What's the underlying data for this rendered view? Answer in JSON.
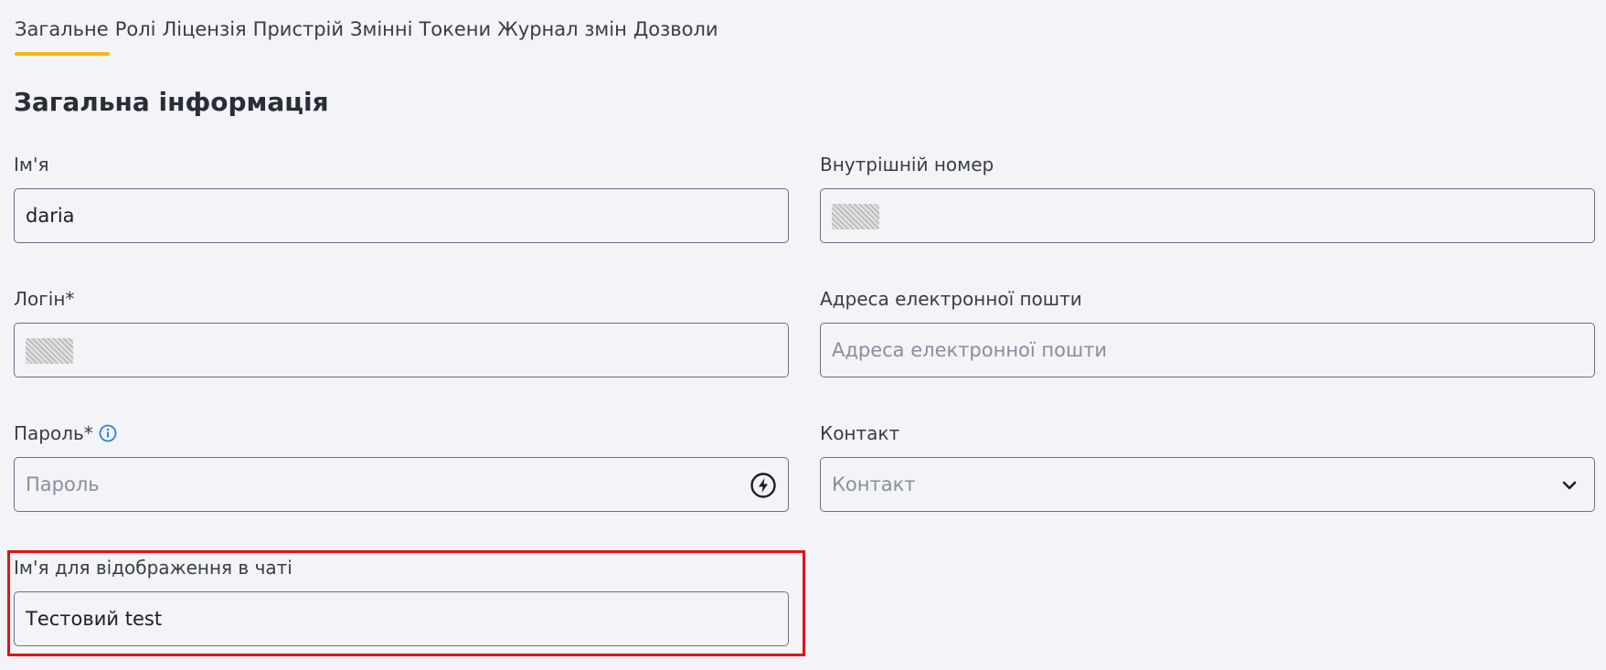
{
  "tabs": [
    {
      "label": "Загальне"
    },
    {
      "label": "Ролі"
    },
    {
      "label": "Ліцензія"
    },
    {
      "label": "Пристрій"
    },
    {
      "label": "Змінні"
    },
    {
      "label": "Токени"
    },
    {
      "label": "Журнал змін"
    },
    {
      "label": "Дозволи"
    }
  ],
  "active_tab": "Загальне",
  "section": {
    "title": "Загальна інформація"
  },
  "fields": {
    "name": {
      "label": "Ім'я",
      "value": "daria"
    },
    "extension": {
      "label": "Внутрішній номер",
      "value": ""
    },
    "login": {
      "label": "Логін*",
      "value": ""
    },
    "email": {
      "label": "Адреса електронної пошти",
      "placeholder": "Адреса електронної пошти"
    },
    "password": {
      "label": "Пароль*",
      "placeholder": "Пароль"
    },
    "contact": {
      "label": "Контакт",
      "placeholder": "Контакт"
    },
    "chat_name": {
      "label": "Ім'я для відображення в чаті",
      "value": "Тестовий test"
    }
  },
  "colors": {
    "accent": "#f6b40e",
    "info": "#2f7fe0",
    "highlight": "#e01414"
  },
  "icons": {
    "password_generate": "lightning-bolt-icon",
    "password_info": "info-icon",
    "contact_dropdown": "chevron-down-icon"
  }
}
